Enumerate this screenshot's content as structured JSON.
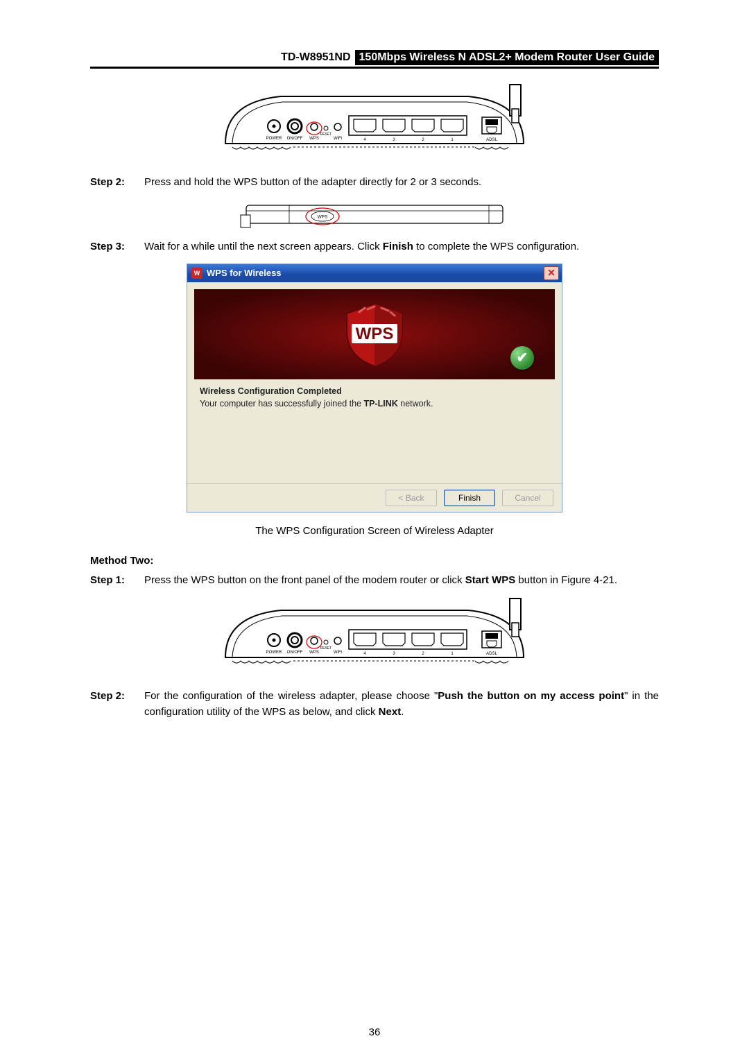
{
  "header": {
    "model": "TD-W8951ND",
    "title": "150Mbps Wireless N ADSL2+ Modem Router User Guide"
  },
  "router_labels": {
    "power": "POWER",
    "onoff": "ON/OFF",
    "wps": "WPS",
    "reset": "RESET",
    "wifi": "WiFi",
    "p4": "4",
    "p3": "3",
    "p2": "2",
    "p1": "1",
    "adsl": "ADSL"
  },
  "adapter_label": "WPS",
  "steps_a": {
    "s2_label": "Step 2:",
    "s2_text": "Press and hold the WPS button of the adapter directly for 2 or 3 seconds.",
    "s3_label": "Step 3:",
    "s3_pre": "Wait for a while until the next screen appears. Click ",
    "s3_bold": "Finish",
    "s3_post": " to complete the WPS configuration."
  },
  "dialog": {
    "title": "WPS for Wireless",
    "shield_text": "WPS",
    "headline": "Wireless Configuration Completed",
    "msg_pre": "Your computer has successfully joined the ",
    "msg_bold": "TP-LINK",
    "msg_post": " network.",
    "btn_back": "< Back",
    "btn_finish": "Finish",
    "btn_cancel": "Cancel"
  },
  "caption": "The WPS Configuration Screen of Wireless Adapter",
  "method_two": "Method Two:",
  "steps_b": {
    "s1_label": "Step 1:",
    "s1_pre": "Press the WPS button on the front panel of the modem router or click ",
    "s1_bold": "Start WPS",
    "s1_post": " button in Figure 4-21.",
    "s2_label": "Step 2:",
    "s2_pre": "For the configuration of the wireless adapter, please choose \"",
    "s2_bold1": "Push the button on my access point",
    "s2_mid": "\" in the configuration utility of the WPS as below, and click ",
    "s2_bold2": "Next",
    "s2_post": "."
  },
  "page_number": "36"
}
